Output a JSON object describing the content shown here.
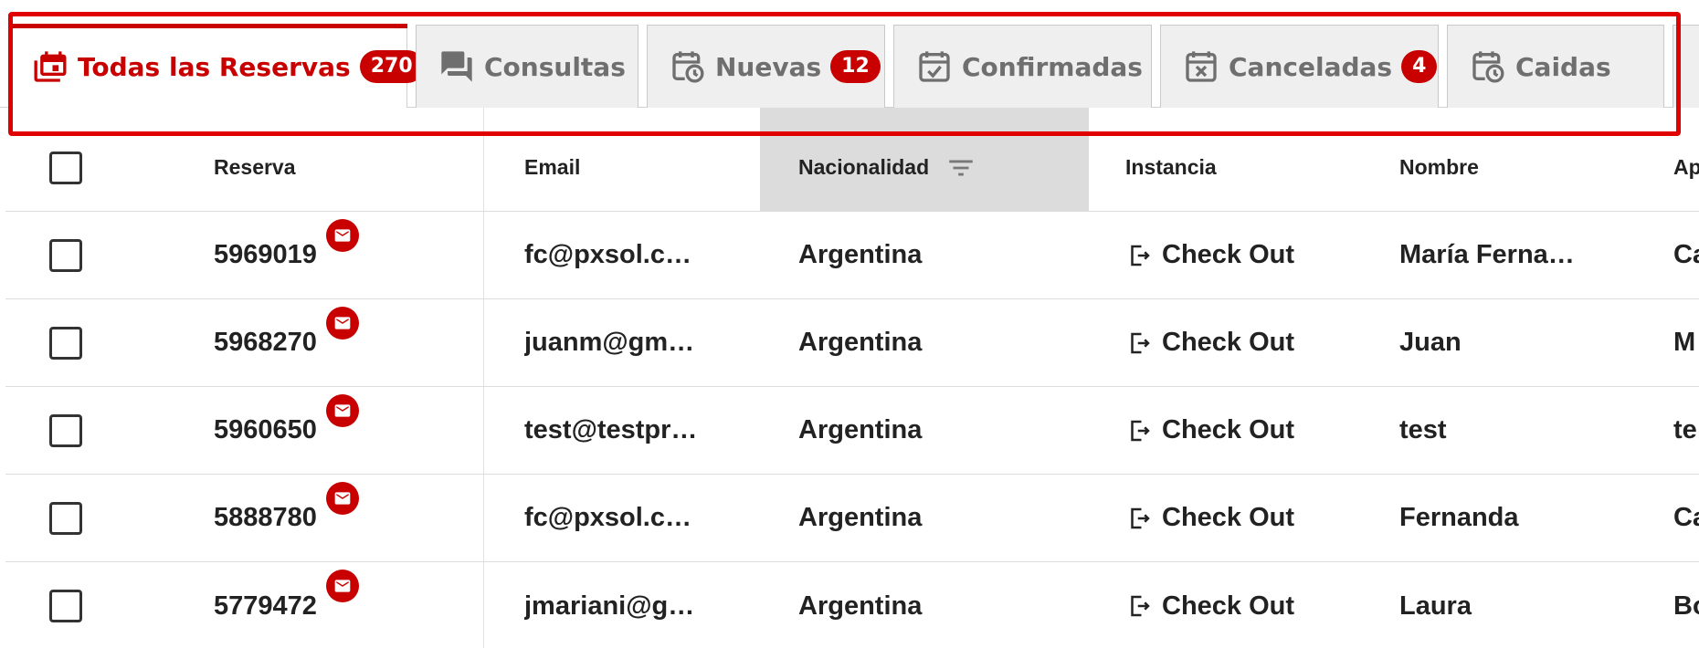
{
  "tabs": [
    {
      "label": "Todas las Reservas",
      "badge": "270",
      "icon": "calendar-multiple-icon",
      "active": true
    },
    {
      "label": "Consultas",
      "badge": "",
      "icon": "chat-bubbles-icon",
      "active": false
    },
    {
      "label": "Nuevas",
      "badge": "12",
      "icon": "calendar-clock-icon",
      "active": false
    },
    {
      "label": "Confirmadas",
      "badge": "",
      "icon": "calendar-check-icon",
      "active": false
    },
    {
      "label": "Canceladas",
      "badge": "4",
      "icon": "calendar-remove-icon",
      "active": false
    },
    {
      "label": "Caidas",
      "badge": "",
      "icon": "calendar-clock-icon",
      "active": false
    }
  ],
  "table": {
    "columns": {
      "reserva": "Reserva",
      "email": "Email",
      "nacionalidad": "Nacionalidad",
      "instancia": "Instancia",
      "nombre": "Nombre",
      "apellido": "Ap"
    },
    "sorted_column": "nacionalidad",
    "rows": [
      {
        "reserva": "5969019",
        "email": "fc@pxsol.c…",
        "nacionalidad": "Argentina",
        "instancia": "Check Out",
        "nombre": "María Ferna…",
        "apellido": "Ca"
      },
      {
        "reserva": "5968270",
        "email": "juanm@gm…",
        "nacionalidad": "Argentina",
        "instancia": "Check Out",
        "nombre": "Juan",
        "apellido": "M"
      },
      {
        "reserva": "5960650",
        "email": "test@testpr…",
        "nacionalidad": "Argentina",
        "instancia": "Check Out",
        "nombre": "test",
        "apellido": "te"
      },
      {
        "reserva": "5888780",
        "email": "fc@pxsol.c…",
        "nacionalidad": "Argentina",
        "instancia": "Check Out",
        "nombre": "Fernanda",
        "apellido": "Ca"
      },
      {
        "reserva": "5779472",
        "email": "jmariani@g…",
        "nacionalidad": "Argentina",
        "instancia": "Check Out",
        "nombre": "Laura",
        "apellido": "Bo"
      }
    ]
  },
  "colors": {
    "accent": "#c80000",
    "highlight": "#e00000",
    "tab_bg": "#efefef",
    "sorted_header_bg": "#dcdcdc"
  },
  "icons": {
    "mail": "mail-icon",
    "filter": "filter-icon",
    "instance": "exit-icon",
    "checkbox": "checkbox-icon"
  }
}
